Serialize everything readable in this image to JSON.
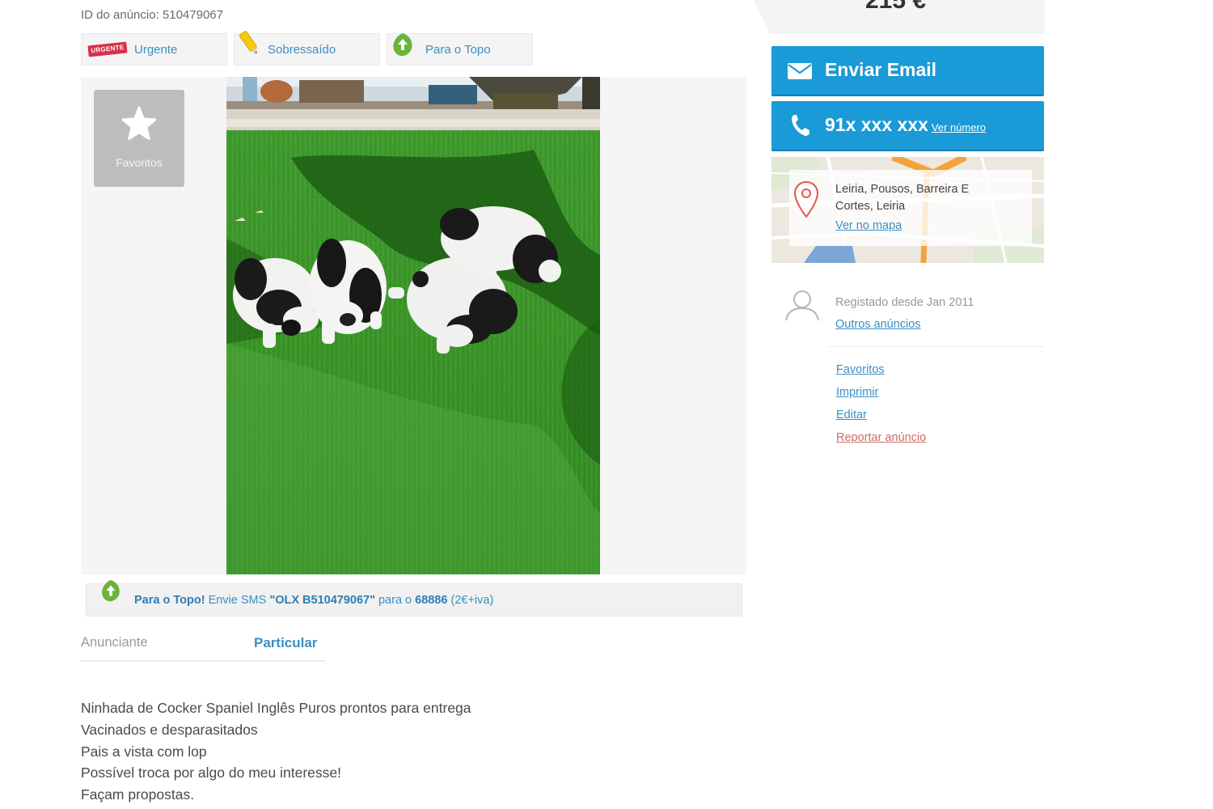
{
  "ad": {
    "id_label": "ID do anúncio:",
    "id_value": "510479067",
    "price": "215 €"
  },
  "promo": [
    {
      "badge": "URGENTE",
      "label": "Urgente",
      "icon": "urgente-badge-icon"
    },
    {
      "label": "Sobressaído",
      "icon": "highlighter-pen-icon"
    },
    {
      "label": "Para o Topo",
      "icon": "arrow-up-leaf-icon"
    }
  ],
  "gallery": {
    "favorites_label": "Favoritos",
    "photo_subject": "puppies-on-grass-photo"
  },
  "sms_bar": {
    "prefix": "Para o Topo!",
    "t1": " Envie SMS ",
    "code": "\"OLX B510479067\"",
    "t2": " para o ",
    "number": "68886",
    "t3": " (2€+iva)"
  },
  "advertiser": {
    "label": "Anunciante",
    "value": "Particular"
  },
  "description": [
    "Ninhada de Cocker Spaniel Inglês Puros prontos para entrega",
    "Vacinados e desparasitados",
    "Pais a vista com lop",
    "Possível troca por algo do meu interesse!",
    "Façam propostas."
  ],
  "contact": {
    "email_label": "Enviar Email",
    "phone_masked": "91x xxx xxx",
    "phone_reveal": "Ver número"
  },
  "location": {
    "line1": "Leiria, Pousos, Barreira E",
    "line2": "Cortes, Leiria",
    "map_link": "Ver no mapa"
  },
  "user": {
    "registered": "Registado desde Jan 2011",
    "other_ads": "Outros anúncios"
  },
  "actions": {
    "favorites": "Favoritos",
    "print": "Imprimir",
    "edit": "Editar",
    "report": "Reportar anúncio"
  },
  "colors": {
    "accent_blue": "#1a9ad6",
    "link_blue": "#3a8fc4",
    "report_red": "#cf6b6b",
    "urgent_red": "#d9304a"
  }
}
